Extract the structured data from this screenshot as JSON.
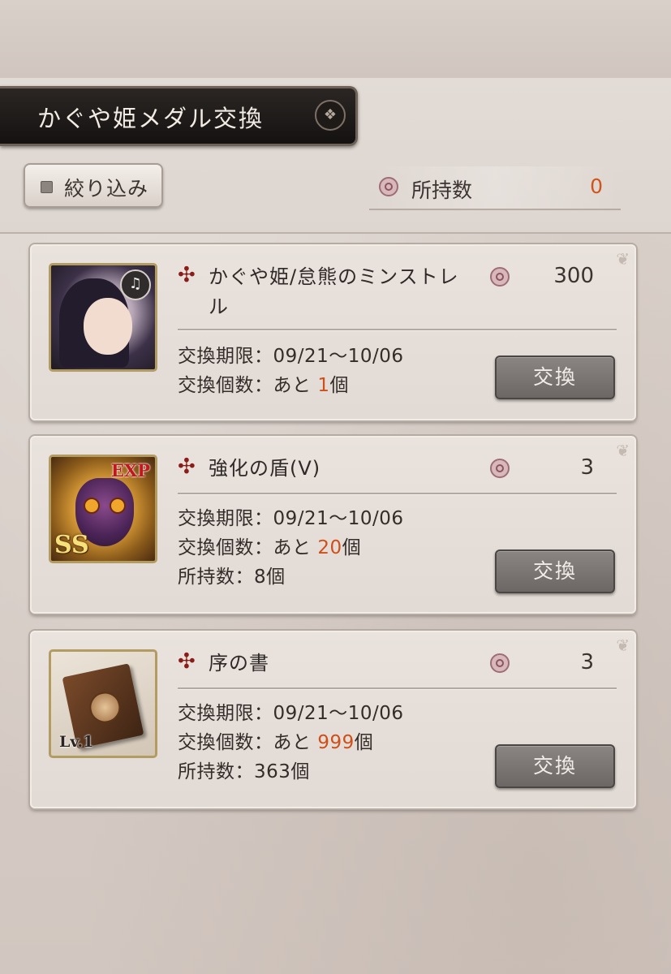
{
  "header": {
    "title": "かぐや姫メダル交換",
    "filter_label": "絞り込み",
    "owned_label": "所持数",
    "owned_value": "0"
  },
  "items": [
    {
      "name": "かぐや姫/怠熊のミンストレル",
      "cost": "300",
      "period_label": "交換期限：",
      "period": "09/21～10/06",
      "limit_label": "交換個数：あと",
      "limit_value": "1",
      "limit_unit": "個",
      "button": "交換",
      "icon": "character-portrait"
    },
    {
      "name": "強化の盾(V)",
      "cost": "3",
      "period_label": "交換期限：",
      "period": "09/21～10/06",
      "limit_label": "交換個数：あと",
      "limit_value": "20",
      "limit_unit": "個",
      "owned_label": "所持数：",
      "owned_value": "8個",
      "button": "交換",
      "icon": "exp-mask",
      "badge_exp": "EXP",
      "badge_rank": "SS"
    },
    {
      "name": "序の書",
      "cost": "3",
      "period_label": "交換期限：",
      "period": "09/21～10/06",
      "limit_label": "交換個数：あと",
      "limit_value": "999",
      "limit_unit": "個",
      "owned_label": "所持数：",
      "owned_value": "363個",
      "button": "交換",
      "icon": "book",
      "badge_level": "Lv.1"
    }
  ],
  "colors": {
    "accent": "#cf4f1a",
    "title_bg": "#1c1816",
    "button_bg": "#7a7572"
  }
}
